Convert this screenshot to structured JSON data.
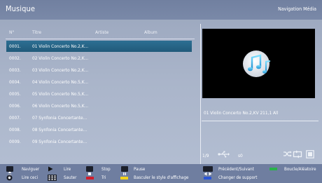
{
  "header": {
    "title": "Musique",
    "mode": "Navigation Média"
  },
  "list": {
    "columns": [
      "N°",
      "Titre",
      "Artiste",
      "Album"
    ],
    "tracks": [
      {
        "num": "0001.",
        "title": "01 Violin Concerto No.2,K...",
        "selected": true
      },
      {
        "num": "0002.",
        "title": "02 Violin Concerto No.2,K..."
      },
      {
        "num": "0003.",
        "title": "03 Violin Concerto No.2,K..."
      },
      {
        "num": "0004.",
        "title": "04 Violin Concerto No.5,K..."
      },
      {
        "num": "0005.",
        "title": "05 Violin Concerto No.5,K..."
      },
      {
        "num": "0006.",
        "title": "06 Violin Concerto No.5,K..."
      },
      {
        "num": "0007.",
        "title": "07 Synfonia Concertante..."
      },
      {
        "num": "0008.",
        "title": "08 Synfonia Concertante..."
      },
      {
        "num": "0009.",
        "title": "09 Synfonia Concertante..."
      }
    ]
  },
  "preview": {
    "now_playing": "01 Violin Concerto No.2,KV 211,1 All",
    "counter": "1/9",
    "source_label": "s0",
    "icons": [
      "music-note-icon",
      "usb-icon",
      "shuffle-icon",
      "repeat-icon",
      "stop-square-icon"
    ]
  },
  "legend": {
    "navigate": "Naviguer",
    "play": "Lire",
    "stop": "Stop",
    "pause": "Pause",
    "prev_next": "Précédent/Suivant",
    "loop_random": "Boucle/Aléatoire",
    "play_this": "Lire ceci",
    "jump": "Sauter",
    "sort": "Tri",
    "toggle_view": "Basculer le style d'affichage",
    "change_source": "Changer de support"
  },
  "colors": {
    "red": "#d01c2a",
    "yellow": "#f2d21b",
    "green": "#2ab24a",
    "blue": "#2a55d6",
    "selection": "#2d6f93"
  }
}
